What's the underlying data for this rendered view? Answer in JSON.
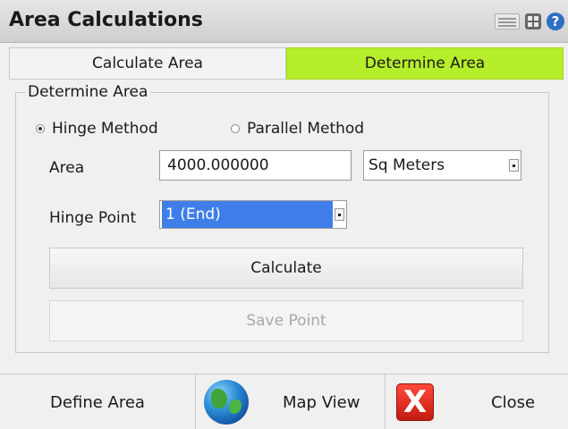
{
  "window": {
    "title": "Area Calculations"
  },
  "toolbar_icons": [
    "keyboard-icon",
    "grid-icon",
    "help-icon"
  ],
  "tabs": [
    {
      "label": "Calculate Area",
      "active": false
    },
    {
      "label": "Determine Area",
      "active": true
    }
  ],
  "active_tab_color": "#b5ee2a",
  "group": {
    "legend": "Determine Area",
    "method": {
      "hinge_label": "Hinge Method",
      "parallel_label": "Parallel Method",
      "selected": "Hinge Method"
    },
    "area": {
      "label": "Area",
      "value": "4000.000000"
    },
    "units": {
      "selected": "Sq Meters"
    },
    "hinge_point": {
      "label": "Hinge Point",
      "selected": "1 (End)"
    },
    "calculate_label": "Calculate",
    "save_point_label": "Save Point"
  },
  "bottom": {
    "define_area_label": "Define Area",
    "map_view_label": "Map View",
    "close_label": "Close",
    "close_icon_glyph": "X"
  }
}
